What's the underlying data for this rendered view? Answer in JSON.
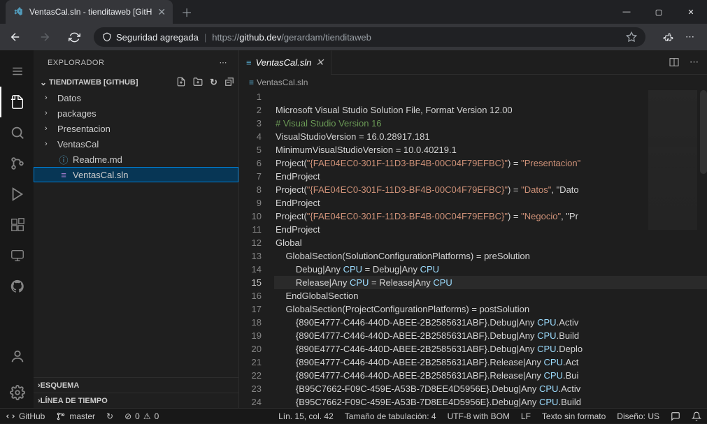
{
  "browser": {
    "tab_title": "VentasCal.sln - tienditaweb [GitH",
    "security_label": "Seguridad agregada",
    "url_scheme": "https://",
    "url_host": "github.dev",
    "url_path": "/gerardam/tienditaweb"
  },
  "sidebar": {
    "title": "EXPLORADOR",
    "workspace": "TIENDITAWEB [GITHUB]",
    "tree": [
      {
        "name": "Datos",
        "type": "folder"
      },
      {
        "name": "packages",
        "type": "folder"
      },
      {
        "name": "Presentacion",
        "type": "folder"
      },
      {
        "name": "VentasCal",
        "type": "folder"
      },
      {
        "name": "Readme.md",
        "type": "file",
        "icon": "info"
      },
      {
        "name": "VentasCal.sln",
        "type": "file",
        "icon": "sln",
        "selected": true
      }
    ],
    "outline": "ESQUEMA",
    "timeline": "LÍNEA DE TIEMPO"
  },
  "editor": {
    "tab_label": "VentasCal.sln",
    "breadcrumb": "VentasCal.sln",
    "current_line": 15,
    "lines": [
      "",
      "Microsoft Visual Studio Solution File, Format Version 12.00",
      "# Visual Studio Version 16",
      "VisualStudioVersion = 16.0.28917.181",
      "MinimumVisualStudioVersion = 10.0.40219.1",
      "Project(\"{FAE04EC0-301F-11D3-BF4B-00C04F79EFBC}\") = \"Presentacion\"",
      "EndProject",
      "Project(\"{FAE04EC0-301F-11D3-BF4B-00C04F79EFBC}\") = \"Datos\", \"Dato",
      "EndProject",
      "Project(\"{FAE04EC0-301F-11D3-BF4B-00C04F79EFBC}\") = \"Negocio\", \"Pr",
      "EndProject",
      "Global",
      "    GlobalSection(SolutionConfigurationPlatforms) = preSolution",
      "        Debug|Any CPU = Debug|Any CPU",
      "        Release|Any CPU = Release|Any CPU",
      "    EndGlobalSection",
      "    GlobalSection(ProjectConfigurationPlatforms) = postSolution",
      "        {890E4777-C446-440D-ABEE-2B2585631ABF}.Debug|Any CPU.Activ",
      "        {890E4777-C446-440D-ABEE-2B2585631ABF}.Debug|Any CPU.Build",
      "        {890E4777-C446-440D-ABEE-2B2585631ABF}.Debug|Any CPU.Deplo",
      "        {890E4777-C446-440D-ABEE-2B2585631ABF}.Release|Any CPU.Act",
      "        {890E4777-C446-440D-ABEE-2B2585631ABF}.Release|Any CPU.Bui",
      "        {B95C7662-F09C-459E-A53B-7D8EE4D5956E}.Debug|Any CPU.Activ",
      "        {B95C7662-F09C-459E-A53B-7D8EE4D5956E}.Debug|Any CPU.Build"
    ]
  },
  "status": {
    "remote": "GitHub",
    "branch": "master",
    "sync": "↻",
    "errors": "0",
    "warnings": "0",
    "ln_col": "Lín. 15, col. 42",
    "tab_size": "Tamaño de tabulación: 4",
    "encoding": "UTF-8 with BOM",
    "eol": "LF",
    "lang": "Texto sin formato",
    "layout": "Diseño: US",
    "notif": "",
    "feedback": ""
  }
}
